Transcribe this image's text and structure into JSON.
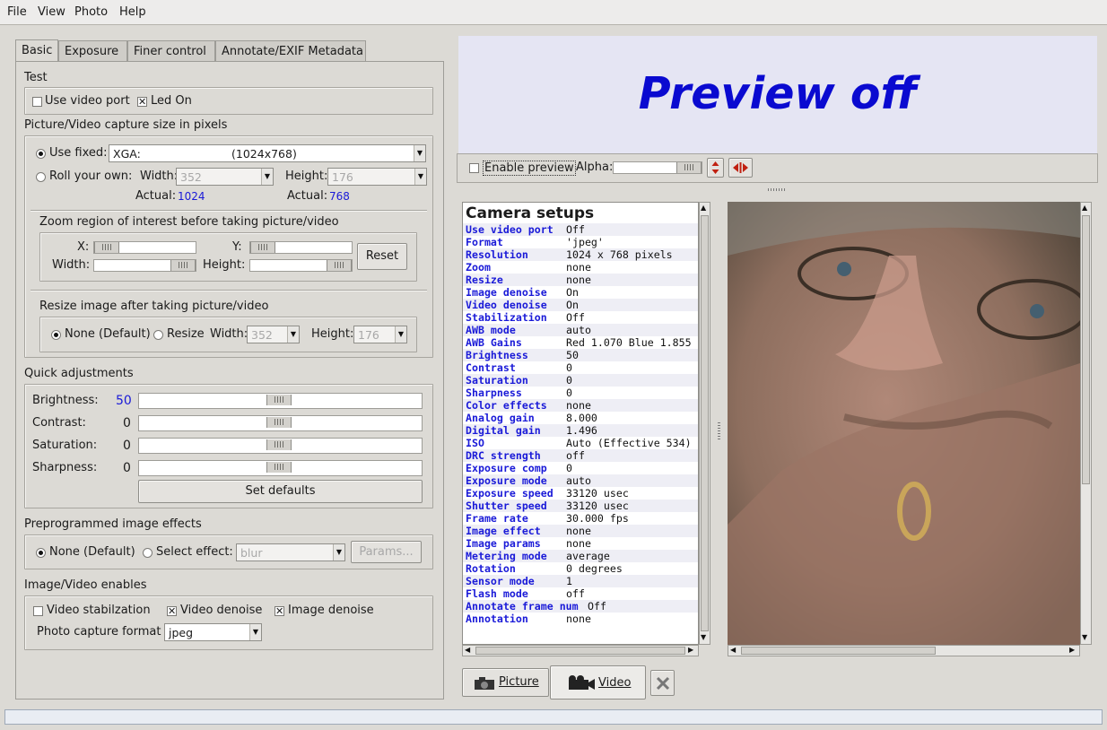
{
  "menu": [
    "File",
    "View",
    "Photo",
    "Help"
  ],
  "tabs": [
    "Basic",
    "Exposure",
    "Finer control",
    "Annotate/EXIF Metadata"
  ],
  "test": {
    "title": "Test",
    "use_video_port": "Use video port",
    "led_on": "Led On"
  },
  "capture": {
    "title": "Picture/Video capture size in pixels",
    "use_fixed": "Use fixed:",
    "fixed_value": "XGA:",
    "fixed_res": "(1024x768)",
    "roll": "Roll your own:",
    "width_label": "Width:",
    "width_value": "352",
    "height_label": "Height:",
    "height_value": "176",
    "actual_label": "Actual:",
    "actual_w": "1024",
    "actual_h": "768"
  },
  "zoom": {
    "title": "Zoom region of interest before taking picture/video",
    "x": "X:",
    "y": "Y:",
    "width": "Width:",
    "height": "Height:",
    "reset": "Reset"
  },
  "resize": {
    "title": "Resize image after taking picture/video",
    "none": "None (Default)",
    "resize": "Resize",
    "width": "Width:",
    "width_value": "352",
    "height": "Height:",
    "height_value": "176"
  },
  "quick": {
    "title": "Quick adjustments",
    "items": [
      {
        "label": "Brightness:",
        "value": "50"
      },
      {
        "label": "Contrast:",
        "value": "0"
      },
      {
        "label": "Saturation:",
        "value": "0"
      },
      {
        "label": "Sharpness:",
        "value": "0"
      }
    ],
    "set_defaults": "Set defaults"
  },
  "effects": {
    "title": "Preprogrammed image effects",
    "none": "None (Default)",
    "select": "Select effect:",
    "effect_value": "blur",
    "params": "Params..."
  },
  "enables": {
    "title": "Image/Video enables",
    "stab": "Video stabilzation",
    "vdenoise": "Video denoise",
    "idenoise": "Image denoise",
    "format_label": "Photo capture format",
    "format_value": "jpeg"
  },
  "preview": {
    "text": "Preview off",
    "enable": "Enable preview",
    "alpha": "Alpha:"
  },
  "setups": {
    "title": "Camera setups",
    "rows": [
      [
        "Use video port",
        "Off"
      ],
      [
        "Format",
        "'jpeg'"
      ],
      [
        "Resolution",
        "1024 x 768 pixels"
      ],
      [
        "Zoom",
        "none"
      ],
      [
        "Resize",
        "none"
      ],
      [
        "Image denoise",
        "On"
      ],
      [
        "Video denoise",
        "On"
      ],
      [
        "Stabilization",
        "Off"
      ],
      [
        "AWB mode",
        "auto"
      ],
      [
        "AWB Gains",
        "Red 1.070 Blue 1.855"
      ],
      [
        "Brightness",
        "50"
      ],
      [
        "Contrast",
        "0"
      ],
      [
        "Saturation",
        "0"
      ],
      [
        "Sharpness",
        "0"
      ],
      [
        "Color effects",
        "none"
      ],
      [
        "Analog gain",
        "8.000"
      ],
      [
        "Digital gain",
        "1.496"
      ],
      [
        "ISO",
        "Auto (Effective 534)"
      ],
      [
        "DRC strength",
        "off"
      ],
      [
        "Exposure comp",
        "0"
      ],
      [
        "Exposure mode",
        "auto"
      ],
      [
        "Exposure speed",
        "33120 usec"
      ],
      [
        "Shutter speed",
        "33120 usec"
      ],
      [
        "Frame rate",
        "30.000 fps"
      ],
      [
        "Image effect",
        "none"
      ],
      [
        "Image params",
        "none"
      ],
      [
        "Metering mode",
        "average"
      ],
      [
        "Rotation",
        "0 degrees"
      ],
      [
        "Sensor mode",
        "1"
      ],
      [
        "Flash mode",
        "off"
      ],
      [
        "Annotate frame num",
        "Off"
      ],
      [
        "Annotation",
        "none"
      ]
    ]
  },
  "actions": {
    "picture": "Picture",
    "video": "Video"
  },
  "colors": {
    "accent_blue": "#1a1ad8",
    "preview_bg": "#e5e5f3"
  }
}
